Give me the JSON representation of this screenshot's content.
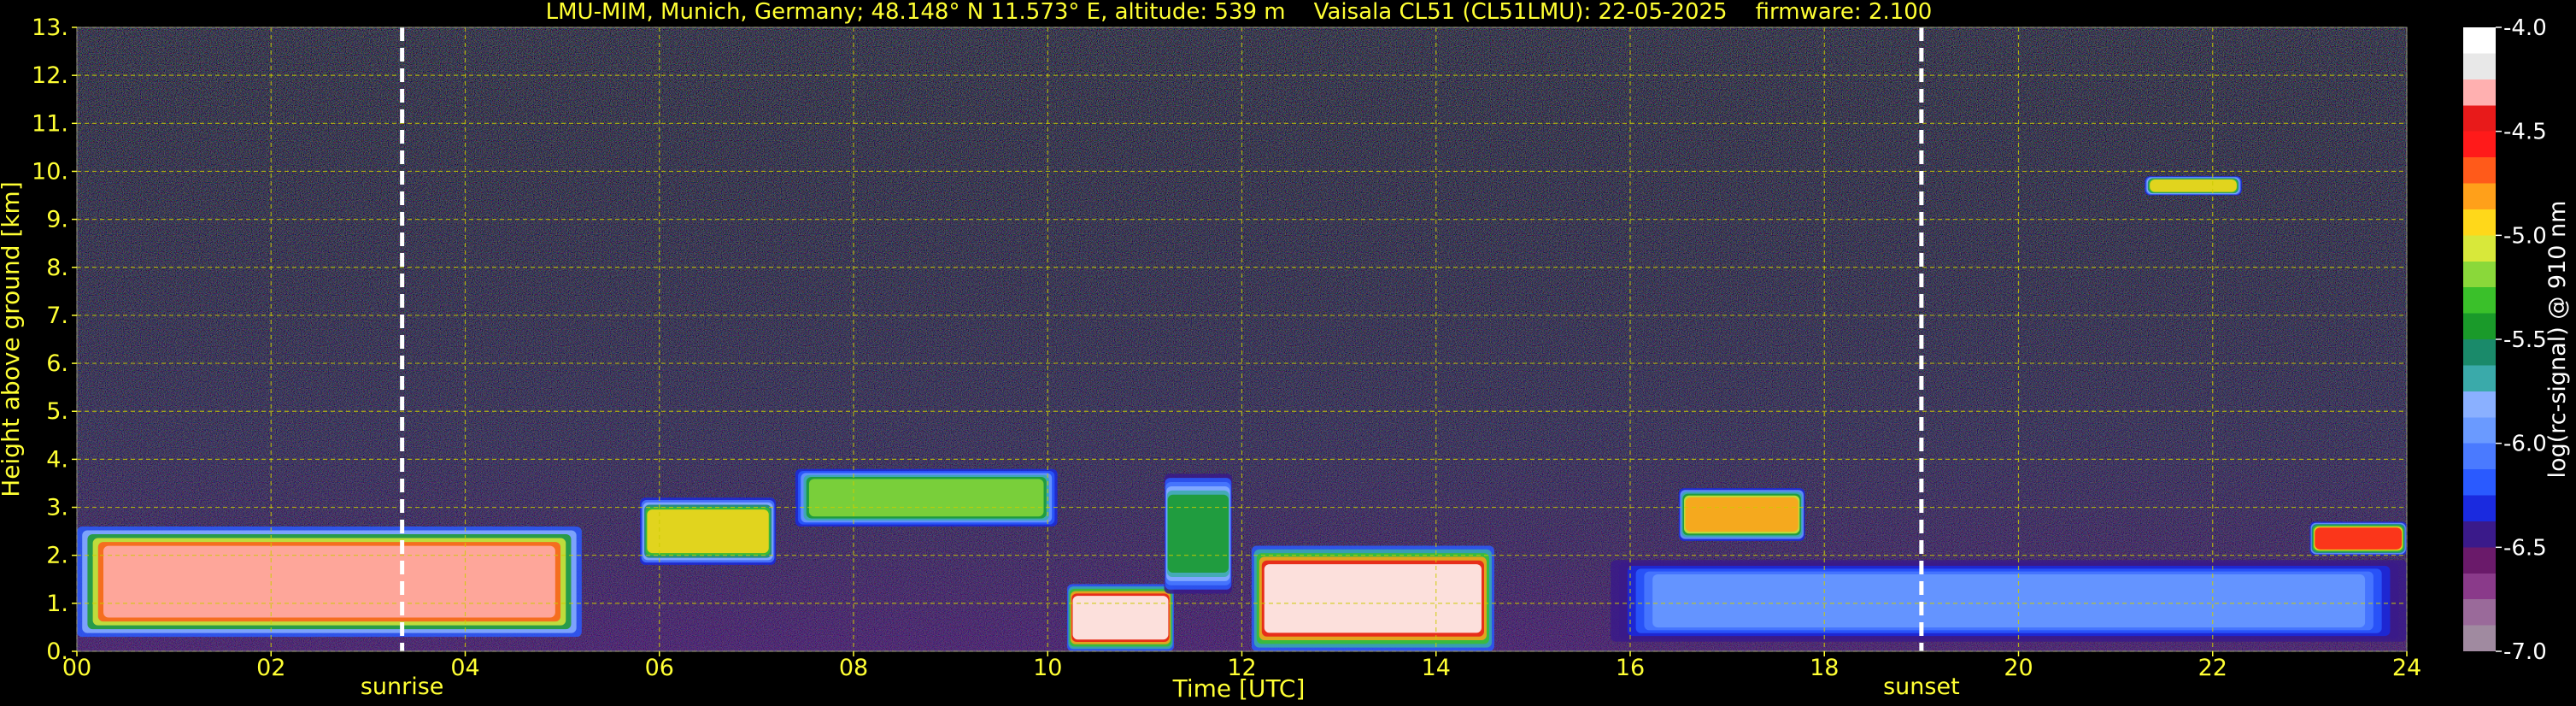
{
  "chart_data": {
    "type": "heatmap",
    "title": "LMU-MIM, Munich, Germany; 48.148° N 11.573° E, altitude: 539 m    Vaisala CL51 (CL51LMU): 22-05-2025    firmware: 2.100",
    "xlabel": "Time [UTC]",
    "ylabel": "Height above ground [km]",
    "colorbar_label": "log(rc-signal) @ 910 nm",
    "xlim": [
      0,
      24
    ],
    "ylim": [
      0,
      13
    ],
    "x_ticks": [
      "00",
      "02",
      "04",
      "06",
      "08",
      "10",
      "12",
      "14",
      "16",
      "18",
      "20",
      "22",
      "24"
    ],
    "x_tick_values": [
      0,
      2,
      4,
      6,
      8,
      10,
      12,
      14,
      16,
      18,
      20,
      22,
      24
    ],
    "y_ticks": [
      "0.",
      "1.",
      "2.",
      "3.",
      "4.",
      "5.",
      "6.",
      "7.",
      "8.",
      "9.",
      "10.",
      "11.",
      "12.",
      "13."
    ],
    "y_tick_values": [
      0,
      1,
      2,
      3,
      4,
      5,
      6,
      7,
      8,
      9,
      10,
      11,
      12,
      13
    ],
    "colorbar_range": [
      -7.0,
      -4.0
    ],
    "colorbar_ticks": [
      "-4.0",
      "-4.5",
      "-5.0",
      "-5.5",
      "-6.0",
      "-6.5",
      "-7.0"
    ],
    "colorbar_tick_values": [
      -4.0,
      -4.5,
      -5.0,
      -5.5,
      -6.0,
      -6.5,
      -7.0
    ],
    "colormap": [
      "#a08aa0",
      "#9a6a9a",
      "#8a3a8a",
      "#6a1a6a",
      "#3a1a8a",
      "#1a2adf",
      "#2a5aff",
      "#4a7aff",
      "#6a9aff",
      "#8ab0ff",
      "#3aaaaa",
      "#1a8a6a",
      "#1a9a2a",
      "#3ac02a",
      "#8ad83a",
      "#d8e83a",
      "#ffd81a",
      "#ffa01a",
      "#ff5a1a",
      "#ff1a1a",
      "#e81a1a",
      "#ffb0b0",
      "#e8e8e8",
      "#ffffff"
    ],
    "grid": true,
    "grid_color": "#cccc00",
    "events": [
      {
        "label": "sunrise",
        "time": 3.35
      },
      {
        "label": "sunset",
        "time": 19.0
      }
    ],
    "layers": [
      {
        "kind": "aerosol",
        "start": 0.0,
        "end": 5.2,
        "base": 0.3,
        "top": 2.6,
        "peak": -4.3
      },
      {
        "kind": "aerosol",
        "start": 5.8,
        "end": 7.2,
        "base": 1.8,
        "top": 3.2,
        "peak": -5.0
      },
      {
        "kind": "aerosol",
        "start": 7.4,
        "end": 10.1,
        "base": 2.6,
        "top": 3.8,
        "peak": -5.2
      },
      {
        "kind": "cloud",
        "start": 10.2,
        "end": 11.3,
        "base": 0.0,
        "top": 1.4,
        "peak": -4.0
      },
      {
        "kind": "aerosol",
        "start": 11.2,
        "end": 11.9,
        "base": 1.2,
        "top": 3.7,
        "peak": -5.5
      },
      {
        "kind": "cloud",
        "start": 12.1,
        "end": 14.6,
        "base": 0.0,
        "top": 2.2,
        "peak": -4.0
      },
      {
        "kind": "aerosol",
        "start": 16.5,
        "end": 17.8,
        "base": 2.3,
        "top": 3.4,
        "peak": -4.8
      },
      {
        "kind": "boundary",
        "start": 15.8,
        "end": 24.0,
        "base": 0.2,
        "top": 1.9,
        "peak": -6.0
      },
      {
        "kind": "cloud",
        "start": 21.3,
        "end": 22.3,
        "base": 9.5,
        "top": 9.9,
        "peak": -5.0
      },
      {
        "kind": "aerosol",
        "start": 23.0,
        "end": 24.0,
        "base": 2.0,
        "top": 2.7,
        "peak": -4.6
      }
    ]
  }
}
